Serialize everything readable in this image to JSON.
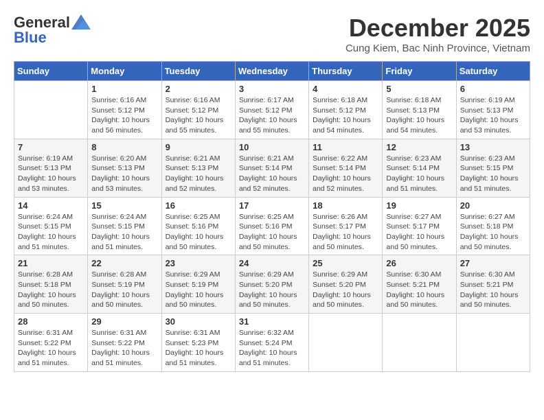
{
  "logo": {
    "general": "General",
    "blue": "Blue"
  },
  "header": {
    "month_title": "December 2025",
    "subtitle": "Cung Kiem, Bac Ninh Province, Vietnam"
  },
  "weekdays": [
    "Sunday",
    "Monday",
    "Tuesday",
    "Wednesday",
    "Thursday",
    "Friday",
    "Saturday"
  ],
  "weeks": [
    [
      {
        "day": "",
        "info": ""
      },
      {
        "day": "1",
        "info": "Sunrise: 6:16 AM\nSunset: 5:12 PM\nDaylight: 10 hours\nand 56 minutes."
      },
      {
        "day": "2",
        "info": "Sunrise: 6:16 AM\nSunset: 5:12 PM\nDaylight: 10 hours\nand 55 minutes."
      },
      {
        "day": "3",
        "info": "Sunrise: 6:17 AM\nSunset: 5:12 PM\nDaylight: 10 hours\nand 55 minutes."
      },
      {
        "day": "4",
        "info": "Sunrise: 6:18 AM\nSunset: 5:12 PM\nDaylight: 10 hours\nand 54 minutes."
      },
      {
        "day": "5",
        "info": "Sunrise: 6:18 AM\nSunset: 5:13 PM\nDaylight: 10 hours\nand 54 minutes."
      },
      {
        "day": "6",
        "info": "Sunrise: 6:19 AM\nSunset: 5:13 PM\nDaylight: 10 hours\nand 53 minutes."
      }
    ],
    [
      {
        "day": "7",
        "info": "Sunrise: 6:19 AM\nSunset: 5:13 PM\nDaylight: 10 hours\nand 53 minutes."
      },
      {
        "day": "8",
        "info": "Sunrise: 6:20 AM\nSunset: 5:13 PM\nDaylight: 10 hours\nand 53 minutes."
      },
      {
        "day": "9",
        "info": "Sunrise: 6:21 AM\nSunset: 5:13 PM\nDaylight: 10 hours\nand 52 minutes."
      },
      {
        "day": "10",
        "info": "Sunrise: 6:21 AM\nSunset: 5:14 PM\nDaylight: 10 hours\nand 52 minutes."
      },
      {
        "day": "11",
        "info": "Sunrise: 6:22 AM\nSunset: 5:14 PM\nDaylight: 10 hours\nand 52 minutes."
      },
      {
        "day": "12",
        "info": "Sunrise: 6:23 AM\nSunset: 5:14 PM\nDaylight: 10 hours\nand 51 minutes."
      },
      {
        "day": "13",
        "info": "Sunrise: 6:23 AM\nSunset: 5:15 PM\nDaylight: 10 hours\nand 51 minutes."
      }
    ],
    [
      {
        "day": "14",
        "info": "Sunrise: 6:24 AM\nSunset: 5:15 PM\nDaylight: 10 hours\nand 51 minutes."
      },
      {
        "day": "15",
        "info": "Sunrise: 6:24 AM\nSunset: 5:15 PM\nDaylight: 10 hours\nand 51 minutes."
      },
      {
        "day": "16",
        "info": "Sunrise: 6:25 AM\nSunset: 5:16 PM\nDaylight: 10 hours\nand 50 minutes."
      },
      {
        "day": "17",
        "info": "Sunrise: 6:25 AM\nSunset: 5:16 PM\nDaylight: 10 hours\nand 50 minutes."
      },
      {
        "day": "18",
        "info": "Sunrise: 6:26 AM\nSunset: 5:17 PM\nDaylight: 10 hours\nand 50 minutes."
      },
      {
        "day": "19",
        "info": "Sunrise: 6:27 AM\nSunset: 5:17 PM\nDaylight: 10 hours\nand 50 minutes."
      },
      {
        "day": "20",
        "info": "Sunrise: 6:27 AM\nSunset: 5:18 PM\nDaylight: 10 hours\nand 50 minutes."
      }
    ],
    [
      {
        "day": "21",
        "info": "Sunrise: 6:28 AM\nSunset: 5:18 PM\nDaylight: 10 hours\nand 50 minutes."
      },
      {
        "day": "22",
        "info": "Sunrise: 6:28 AM\nSunset: 5:19 PM\nDaylight: 10 hours\nand 50 minutes."
      },
      {
        "day": "23",
        "info": "Sunrise: 6:29 AM\nSunset: 5:19 PM\nDaylight: 10 hours\nand 50 minutes."
      },
      {
        "day": "24",
        "info": "Sunrise: 6:29 AM\nSunset: 5:20 PM\nDaylight: 10 hours\nand 50 minutes."
      },
      {
        "day": "25",
        "info": "Sunrise: 6:29 AM\nSunset: 5:20 PM\nDaylight: 10 hours\nand 50 minutes."
      },
      {
        "day": "26",
        "info": "Sunrise: 6:30 AM\nSunset: 5:21 PM\nDaylight: 10 hours\nand 50 minutes."
      },
      {
        "day": "27",
        "info": "Sunrise: 6:30 AM\nSunset: 5:21 PM\nDaylight: 10 hours\nand 50 minutes."
      }
    ],
    [
      {
        "day": "28",
        "info": "Sunrise: 6:31 AM\nSunset: 5:22 PM\nDaylight: 10 hours\nand 51 minutes."
      },
      {
        "day": "29",
        "info": "Sunrise: 6:31 AM\nSunset: 5:22 PM\nDaylight: 10 hours\nand 51 minutes."
      },
      {
        "day": "30",
        "info": "Sunrise: 6:31 AM\nSunset: 5:23 PM\nDaylight: 10 hours\nand 51 minutes."
      },
      {
        "day": "31",
        "info": "Sunrise: 6:32 AM\nSunset: 5:24 PM\nDaylight: 10 hours\nand 51 minutes."
      },
      {
        "day": "",
        "info": ""
      },
      {
        "day": "",
        "info": ""
      },
      {
        "day": "",
        "info": ""
      }
    ]
  ]
}
